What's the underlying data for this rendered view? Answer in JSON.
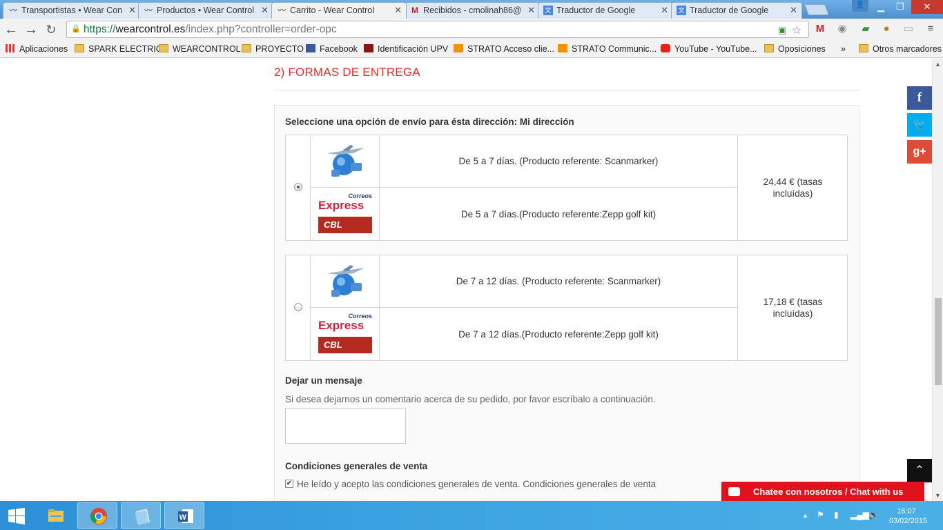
{
  "browser": {
    "tabs": [
      {
        "title": "Transportistas • Wear Con",
        "icon": "wearcontrol-icon"
      },
      {
        "title": "Productos • Wear Control",
        "icon": "wearcontrol-icon"
      },
      {
        "title": "Carrito - Wear Control",
        "icon": "wearcontrol-icon",
        "active": true
      },
      {
        "title": "Recibidos - cmolinah86@",
        "icon": "gmail-icon"
      },
      {
        "title": "Traductor de Google",
        "icon": "translate-icon"
      },
      {
        "title": "Traductor de Google",
        "icon": "translate-icon"
      }
    ],
    "url": {
      "scheme": "https://",
      "host": "wearcontrol.es",
      "path": "/index.php?controller=order-opc"
    },
    "bookmarks": [
      {
        "label": "Aplicaciones",
        "icon": "apps-icon"
      },
      {
        "label": "SPARK ELECTRIC",
        "icon": "folder-icon"
      },
      {
        "label": "WEARCONTROL",
        "icon": "folder-icon"
      },
      {
        "label": "PROYECTO",
        "icon": "folder-icon"
      },
      {
        "label": "Facebook",
        "icon": "facebook-icon"
      },
      {
        "label": "Identificación UPV",
        "icon": "upv-icon"
      },
      {
        "label": "STRATO Acceso clie...",
        "icon": "strato-icon"
      },
      {
        "label": "STRATO Communic...",
        "icon": "strato-icon"
      },
      {
        "label": "YouTube - YouTube...",
        "icon": "youtube-icon"
      },
      {
        "label": "Oposiciones",
        "icon": "folder-icon"
      }
    ],
    "bookmarks_more": "»",
    "other_bookmarks": "Otros marcadores"
  },
  "checkout": {
    "section_title": "2)  FORMAS DE ENTREGA",
    "select_label": "Seleccione una opción de envío para ésta dirección: Mi dirección",
    "options": [
      {
        "selected": true,
        "rows": [
          {
            "logo": "plane-globe-logo",
            "description": "De 5 a 7 días. (Producto referente: Scanmarker)"
          },
          {
            "logo": "correos-express-cbl-logo",
            "description": "De 5 a 7 días.(Producto referente:Zepp golf kit)"
          }
        ],
        "price": "24,44 € (tasas incluídas)"
      },
      {
        "selected": false,
        "rows": [
          {
            "logo": "plane-globe-logo",
            "description": "De 7 a 12 días. (Producto referente: Scanmarker)"
          },
          {
            "logo": "correos-express-cbl-logo",
            "description": "De 7 a 12 días.(Producto referente:Zepp golf kit)"
          }
        ],
        "price": "17,18 € (tasas incluídas)"
      }
    ],
    "logo_text": {
      "correos": "Correos",
      "express": "Express",
      "cbl": "CBL"
    },
    "message_heading": "Dejar un mensaje",
    "message_hint": "Si desea dejarnos un comentario acerca de su pedido, por favor escríbalo a continuación.",
    "message_value": "",
    "terms_heading": "Condiciones generales de venta",
    "terms_checkbox_label": "He leído y acepto las condiciones generales de venta. Condiciones generales de venta",
    "terms_checked": true
  },
  "social": [
    {
      "name": "facebook",
      "glyph": "f",
      "color": "#3b5998"
    },
    {
      "name": "twitter",
      "glyph": "🐦",
      "color": "#00aced"
    },
    {
      "name": "google-plus",
      "glyph": "g+",
      "color": "#dd4b39"
    }
  ],
  "chat_label": "Chatee con nosotros / Chat with us",
  "taskbar": {
    "time": "16:07",
    "date": "03/02/2015"
  },
  "colors": {
    "accent_red": "#e52d27",
    "chat_red": "#e0121b"
  }
}
